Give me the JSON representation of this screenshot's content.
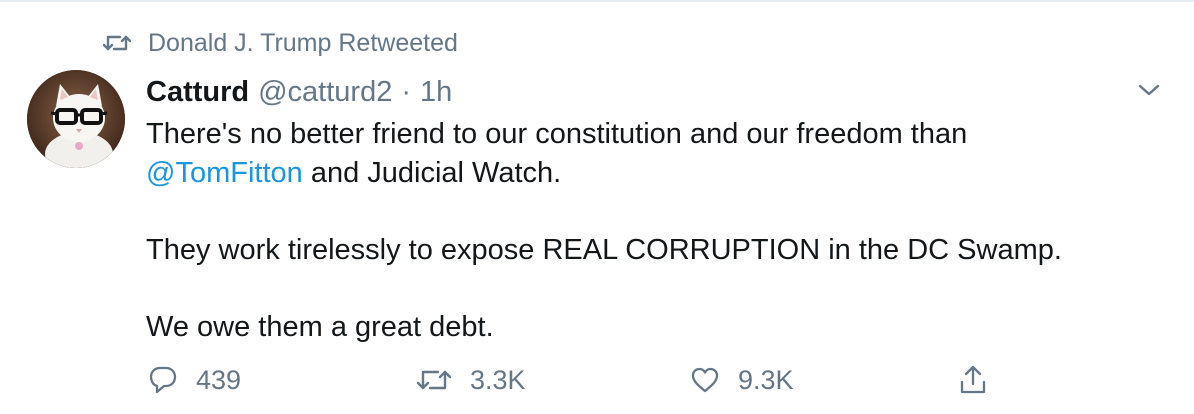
{
  "retweet_context": {
    "text": "Donald J. Trump Retweeted",
    "icon": "retweet-icon"
  },
  "tweet": {
    "author_name": "Catturd",
    "author_handle": "@catturd2",
    "separator": "·",
    "timestamp": "1h",
    "avatar": "avatar-image",
    "caret_icon": "chevron-down-icon",
    "text": {
      "line1": "There's no better friend to our constitution and our freedom than",
      "mention": "@TomFitton",
      "line2_rest": " and Judicial Watch.",
      "line3": "They work tirelessly to expose REAL CORRUPTION in the DC Swamp.",
      "line4": "We owe them a great debt."
    }
  },
  "actions": {
    "reply": {
      "icon": "reply-icon",
      "count": "439"
    },
    "retweet": {
      "icon": "retweet-icon",
      "count": "3.3K"
    },
    "like": {
      "icon": "heart-icon",
      "count": "9.3K"
    },
    "share": {
      "icon": "share-icon"
    }
  },
  "colors": {
    "text_primary": "#14171a",
    "text_secondary": "#657786",
    "link": "#1b95e0",
    "border": "#e6ecf0"
  }
}
